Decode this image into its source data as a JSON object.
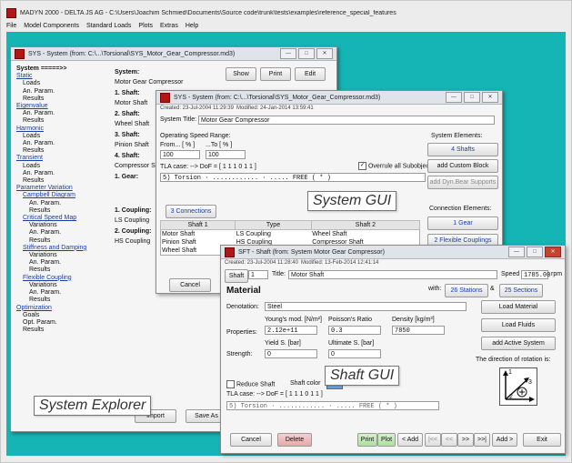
{
  "app": {
    "title": "MADYN 2000 - DELTA JS AG - C:\\Users\\Joachim Schmied\\Documents\\Source code\\trunk\\tests\\examples\\reference_special_features",
    "menu": [
      "File",
      "Model Components",
      "Standard Loads",
      "Plots",
      "Extras",
      "Help"
    ]
  },
  "explorer": {
    "title": "SYS - System (from: C:\\...\\Torsional\\SYS_Motor_Gear_Compressor.md3)",
    "tree": [
      {
        "label": "System =====>>",
        "level": 0,
        "type": "bold"
      },
      {
        "label": "Static",
        "level": 0,
        "type": "link"
      },
      {
        "label": "Loads",
        "level": 1,
        "type": "text"
      },
      {
        "label": "An. Param.",
        "level": 1,
        "type": "text"
      },
      {
        "label": "Results",
        "level": 1,
        "type": "text"
      },
      {
        "label": "Eigenvalue",
        "level": 0,
        "type": "link"
      },
      {
        "label": "An. Param.",
        "level": 1,
        "type": "text"
      },
      {
        "label": "Results",
        "level": 1,
        "type": "text"
      },
      {
        "label": "Harmonic",
        "level": 0,
        "type": "link"
      },
      {
        "label": "Loads",
        "level": 1,
        "type": "text"
      },
      {
        "label": "An. Param.",
        "level": 1,
        "type": "text"
      },
      {
        "label": "Results",
        "level": 1,
        "type": "text"
      },
      {
        "label": "Transient",
        "level": 0,
        "type": "link"
      },
      {
        "label": "Loads",
        "level": 1,
        "type": "text"
      },
      {
        "label": "An. Param.",
        "level": 1,
        "type": "text"
      },
      {
        "label": "Results",
        "level": 1,
        "type": "text"
      },
      {
        "label": "Parameter Variation",
        "level": 0,
        "type": "link"
      },
      {
        "label": "Campbell Diagram",
        "level": 1,
        "type": "link"
      },
      {
        "label": "An. Param.",
        "level": 2,
        "type": "text"
      },
      {
        "label": "Results",
        "level": 2,
        "type": "text"
      },
      {
        "label": "Critical Speed Map",
        "level": 1,
        "type": "link"
      },
      {
        "label": "Variations",
        "level": 2,
        "type": "text"
      },
      {
        "label": "An. Param.",
        "level": 2,
        "type": "text"
      },
      {
        "label": "Results",
        "level": 2,
        "type": "text"
      },
      {
        "label": "Stiffness and Damping",
        "level": 1,
        "type": "link"
      },
      {
        "label": "Variations",
        "level": 2,
        "type": "text"
      },
      {
        "label": "An. Param.",
        "level": 2,
        "type": "text"
      },
      {
        "label": "Results",
        "level": 2,
        "type": "text"
      },
      {
        "label": "Flexible Coupling",
        "level": 1,
        "type": "link"
      },
      {
        "label": "Variations",
        "level": 2,
        "type": "text"
      },
      {
        "label": "An. Param.",
        "level": 2,
        "type": "text"
      },
      {
        "label": "Results",
        "level": 2,
        "type": "text"
      },
      {
        "label": "Optimization",
        "level": 0,
        "type": "link"
      },
      {
        "label": "Goals",
        "level": 1,
        "type": "text"
      },
      {
        "label": "Opt. Param.",
        "level": 1,
        "type": "text"
      },
      {
        "label": "Results",
        "level": 1,
        "type": "text"
      }
    ],
    "col": {
      "system_label": "System:",
      "system_value": "Motor Gear Compressor",
      "shaft1_label": "1. Shaft:",
      "shaft1_value": "Motor Shaft",
      "shaft2_label": "2. Shaft:",
      "shaft2_value": "Wheel Shaft",
      "shaft3_label": "3. Shaft:",
      "shaft3_value": "Pinion Shaft",
      "shaft4_label": "4. Shaft:",
      "shaft4_value": "Compressor S",
      "gear_label": "1. Gear:",
      "coupling1_label": "1. Coupling:",
      "coupling1_value": "LS Coupling",
      "coupling2_label": "2. Coupling:",
      "coupling2_value": "HS Coupling"
    },
    "buttons": {
      "show": "Show",
      "print": "Print",
      "edit": "Edit",
      "import": "Import",
      "save_as": "Save As"
    },
    "label": "System Explorer"
  },
  "system_gui": {
    "title": "SYS - System (from: C:\\...\\Torsional\\SYS_Motor_Gear_Compressor.md3)",
    "created": "Created: 23-Jul-2004 11:29:39",
    "modified": "Modified: 24-Jan-2014 13:59:41",
    "title_label": "System Title:",
    "title_value": "Motor Gear Compressor",
    "op_range_label": "Operating Speed Range:",
    "from_label": "From... [ % ]",
    "to_label": "...To [ % ]",
    "from_value": "100",
    "to_value": "100",
    "tla_label": "TLA case: --> DoF = [ 1 1 1 0 1 1 ]",
    "overrule_label": "Overrule all Subobjects",
    "dropdown_value": "5) Torsion  · ............ · ..... FREE ( * )",
    "system_elements_label": "System Elements:",
    "btn_4_shafts": "4 Shafts",
    "btn_add_custom": "add Custom Block",
    "btn_add_dyn": "add Dyn.Bear Supports",
    "btn_3_connections": "3 Connections",
    "connection_elements_label": "Connection Elements:",
    "btn_1_gear": "1 Gear",
    "btn_2_flex": "2 Flexible Couplings",
    "table": {
      "headers": [
        "Shaft 1",
        "Type",
        "Shaft 2"
      ],
      "rows": [
        [
          "Motor Shaft",
          "LS Coupling",
          "Wheel Shaft"
        ],
        [
          "Pinion Shaft",
          "HS Coupling",
          "Compressor Shaft"
        ],
        [
          "Wheel Shaft",
          "",
          ""
        ]
      ]
    },
    "btn_cancel": "Cancel",
    "label": "System GUI"
  },
  "shaft_gui": {
    "title": "SFT - Shaft (from: System Motor Gear Compressor)",
    "created": "Created: 23-Jul-2004 11:28:40",
    "modified": "Modified: 13-Feb-2014 12:41:14",
    "shaft_btn": "Shaft",
    "shaft_select": "1",
    "title_label": "Title:",
    "title_value": "Motor Shaft",
    "speed_label": "Speed",
    "speed_value": "1785.00",
    "speed_unit": "rpm",
    "material_heading": "Material",
    "with_label": "with:",
    "stations_btn": "26 Stations",
    "amp": "&",
    "sections_btn": "25 Sections",
    "denotation_label": "Denotation:",
    "denotation_value": "Steel",
    "btn_load_material": "Load Material",
    "btn_load_fluids": "Load Fluids",
    "btn_add_active": "add Active System",
    "properties_label": "Properties:",
    "youngs_label": "Young's mod. [N/m²]",
    "youngs_value": "2.12e+11",
    "poisson_label": "Poisson's Ratio",
    "poisson_value": "0.3",
    "density_label": "Density [kg/m³]",
    "density_value": "7850",
    "strength_label": "Strength:",
    "yield_label": "Yield S. [bar]",
    "yield_value": "0",
    "ultimate_label": "Ultimate S. [bar]",
    "ultimate_value": "0",
    "rotation_label": "The direction of rotation is:",
    "rot_axes": {
      "a1": "1",
      "a2": "2",
      "a3": "3"
    },
    "reduce_label": "Reduce Shaft",
    "shaft_color_label": "Shaft color",
    "tla_label": "TLA case: --> DoF = [ 1 1 1 0 1 1 ]",
    "dropdown_value": "5) Torsion  · ............ · ..... FREE ( * )",
    "btn_cancel": "Cancel",
    "btn_delete": "Delete",
    "btn_print": "Print",
    "btn_plot": "Plot",
    "btn_add_left": "< Add",
    "btn_first": "|<<",
    "btn_prev": "<<",
    "btn_next": ">>",
    "btn_last": ">>|",
    "btn_add_right": "Add >",
    "btn_exit": "Exit",
    "label": "Shaft GUI"
  },
  "colors": {
    "workspace": "#15b5b5",
    "link": "#1a3fa0",
    "delete": "#e6a8a8",
    "print_plot": "#aedfa0"
  }
}
